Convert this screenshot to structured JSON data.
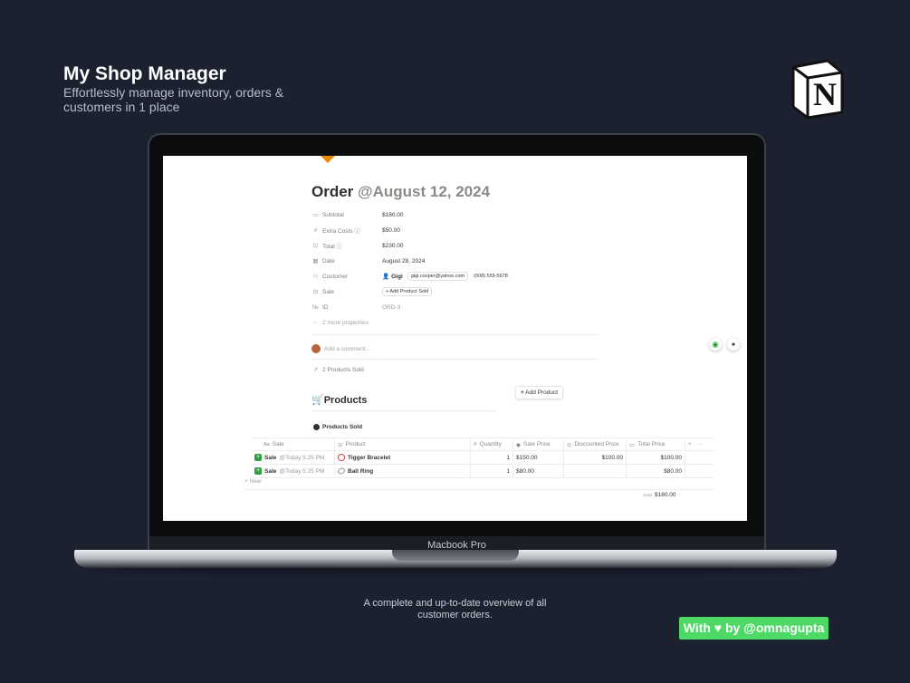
{
  "header": {
    "title": "My Shop Manager",
    "subtitle": "Effortlessly manage inventory, orders & customers in 1 place"
  },
  "logo": {
    "letter": "N",
    "icon": "notion-logo-icon"
  },
  "laptop": {
    "model_label": "Macbook Pro"
  },
  "page": {
    "title": "Order",
    "date_mention": "@August 12, 2024",
    "properties": [
      {
        "icon": "money-icon",
        "glyph": "▭",
        "label": "Subtotal",
        "value": "$180.00"
      },
      {
        "icon": "hash-icon",
        "glyph": "#",
        "label": "Extra Costs ⓘ",
        "value": "$50.00"
      },
      {
        "icon": "money-icon",
        "glyph": "⊡",
        "label": "Total ⓘ",
        "value": "$230.00"
      },
      {
        "icon": "calendar-icon",
        "glyph": "▦",
        "label": "Date",
        "value": "August 28, 2024"
      },
      {
        "icon": "people-icon",
        "glyph": "⚇",
        "label": "Customer",
        "value": ""
      },
      {
        "icon": "relation-icon",
        "glyph": "⊟",
        "label": "Sale",
        "value": ""
      },
      {
        "icon": "id-icon",
        "glyph": "№",
        "label": "ID",
        "value": "ORD-3"
      }
    ],
    "customer": {
      "name": "Gigi",
      "email": "gigi.cooper@yahoo.com",
      "phone": "(608) 555-5678"
    },
    "sale_button": "+ Add Product Sold",
    "more_properties": "2 more properties",
    "comment_placeholder": "Add a comment...",
    "backlinks": "2 Products Sold",
    "add_product_button": "Add Product",
    "products_heading": "Products",
    "view_name": "Products Sold",
    "table": {
      "columns": [
        "Sale",
        "Product",
        "Quantity",
        "Sale Price",
        "Discounted Price",
        "Total Price"
      ],
      "column_icons": [
        "Aa",
        "⊙",
        "#",
        "◆",
        "⊙",
        "▭"
      ],
      "rows": [
        {
          "sale": "Sale",
          "sale_time": "@Today 5:25 PM",
          "product": "Tigger Bracelet",
          "quantity": "1",
          "sale_price": "$150.00",
          "discounted_price": "$100.00",
          "total_price": "$100.00"
        },
        {
          "sale": "Sale",
          "sale_time": "@Today 5:25 PM",
          "product": "Ball Ring",
          "quantity": "1",
          "sale_price": "$80.00",
          "discounted_price": "",
          "total_price": "$80.00"
        }
      ],
      "new_label": "+ New",
      "sum_label": "SUM",
      "sum_value": "$180.00"
    }
  },
  "caption": "A complete and up-to-date overview of all customer orders.",
  "credit": "With ♥ by @omnagupta",
  "colors": {
    "background": "#1c2130",
    "credit_green": "#4cd964",
    "bookmark": "#e8890c"
  }
}
